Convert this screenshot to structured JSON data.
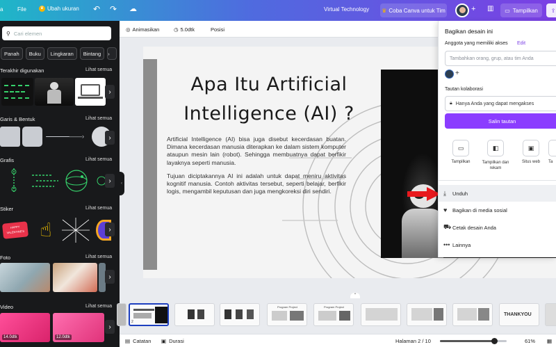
{
  "topbar": {
    "file": "File",
    "resize": "Ubah ukuran",
    "team_name": "Virtual Technology",
    "try_canva": "Coba Canva untuk Tim",
    "share": "Tampilkan"
  },
  "left": {
    "search_placeholder": "Cari elemen",
    "chips": [
      "Panah",
      "Buku",
      "Lingkaran",
      "Bintang"
    ],
    "sections": [
      {
        "title": "Terakhir digunakan",
        "all": "Lihat semua"
      },
      {
        "title": "Garis & Bentuk",
        "all": "Lihat semua"
      },
      {
        "title": "Grafis",
        "all": "Lihat semua"
      },
      {
        "title": "Stiker",
        "all": "Lihat semua"
      },
      {
        "title": "Foto",
        "all": "Lihat semua"
      },
      {
        "title": "Video",
        "all": "Lihat semua"
      }
    ],
    "video_durations": [
      "14.0dtk",
      "12.0dtk"
    ]
  },
  "toolbar": {
    "animate": "Animasikan",
    "duration": "5.0dtk",
    "position": "Posisi"
  },
  "slide": {
    "title_line1": "Apa Itu Artificial",
    "title_line2": "Intelligence (AI) ?",
    "para1": "Artificial Intelligence (AI) bisa juga disebut kecerdasan buatan. Dimana kecerdasan manusia diterapkan ke dalam sistem komputer ataupun mesin lain (robot). Sehingga membuatnya dapat berfikir layaknya seperti manusia.",
    "para2": "Tujuan diciptakannya AI ini adalah untuk dapat meniru aktivitas kognitif manusia. Contoh aktivitas tersebut, seperti belajar, berfikir logis, mengambil keputusan dan juga mengkoreksi diri sendiri."
  },
  "pages": {
    "selected_number": "2",
    "thumb_texts": [
      "Program Project",
      "Program Project",
      "THANKYOU"
    ]
  },
  "bottombar": {
    "notes": "Catatan",
    "duration": "Durasi",
    "page_label": "Halaman 2 / 10",
    "zoom": "61%",
    "zoom_fraction": 0.61
  },
  "share": {
    "title": "Bagikan desain ini",
    "members_label": "Anggota yang memiliki akses",
    "edit": "Edit",
    "add_placeholder": "Tambahkan orang, grup, atau tim Anda",
    "collab_link_label": "Tautan kolaborasi",
    "link_access": "Hanya Anda yang dapat mengakses",
    "copy_link": "Salin tautan",
    "options": [
      "Tampilkan",
      "Tampilkan dan rekam",
      "Situs web",
      "Ta"
    ],
    "menu": [
      "Unduh",
      "Bagikan di media sosial",
      "Cetak desain Anda",
      "Lainnya"
    ]
  },
  "colors": {
    "accent": "#8b3dff",
    "panel_dark": "#18191b",
    "highlight_arrow": "#e8191e"
  }
}
